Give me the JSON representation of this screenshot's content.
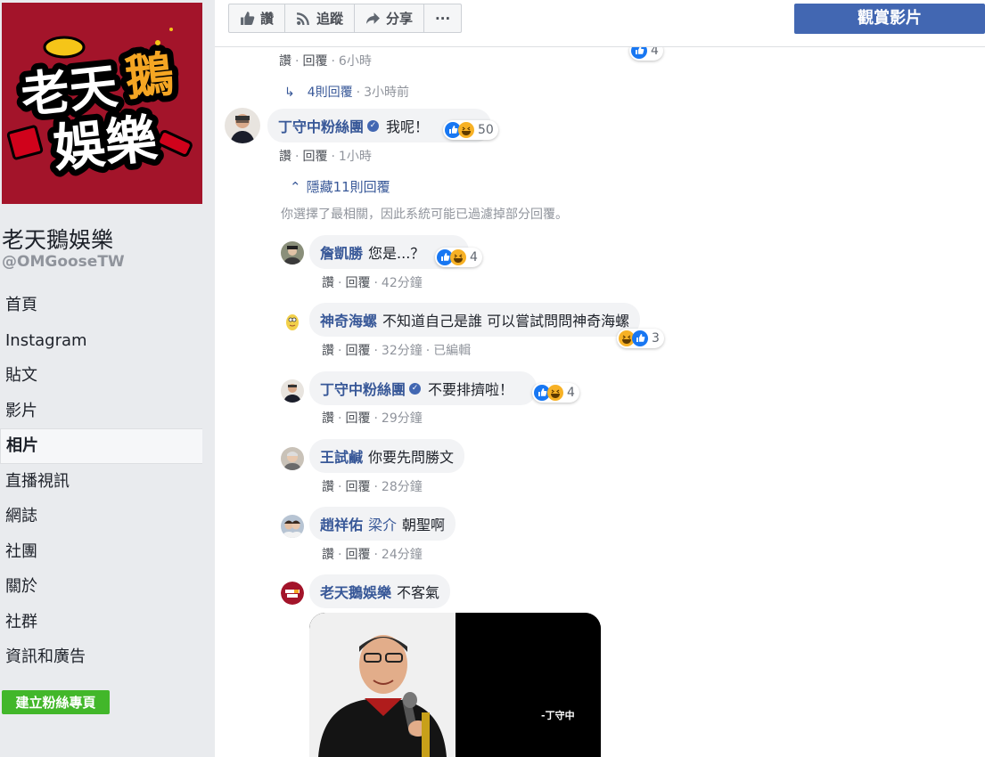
{
  "page": {
    "name": "老天鵝娛樂",
    "handle": "@OMGooseTW",
    "logo_line1": "老天鵝",
    "logo_line2": "娛樂"
  },
  "nav": {
    "items": [
      "首頁",
      "Instagram",
      "貼文",
      "影片",
      "相片",
      "直播視訊",
      "網誌",
      "社團",
      "關於",
      "社群",
      "資訊和廣告"
    ],
    "active": "相片"
  },
  "create_page_button": "建立粉絲專頁",
  "toolbar": {
    "like": "讚",
    "follow": "追蹤",
    "share": "分享",
    "more": "···",
    "watch_video": "觀賞影片"
  },
  "actions": {
    "like": "讚",
    "reply": "回覆",
    "edited": "已編輯"
  },
  "top_partial": {
    "time": "6小時",
    "reaction_count": "4"
  },
  "replies_link": {
    "label": "4則回覆",
    "time": "3小時前"
  },
  "main_comment": {
    "author": "丁守中粉絲團",
    "text": "我呢！",
    "reaction_count": "50",
    "time": "1小時"
  },
  "hide_replies": "隱藏11則回覆",
  "filter_notice": "你選擇了最相關，因此系統可能已過濾掉部分回覆。",
  "replies": [
    {
      "author": "詹凱勝",
      "text": "您是...？",
      "reaction_count": "4",
      "time": "42分鐘"
    },
    {
      "author": "神奇海螺",
      "text": "不知道自己是誰 可以嘗試問問神奇海螺",
      "reaction_count": "3",
      "time": "32分鐘"
    },
    {
      "author": "丁守中粉絲團",
      "text": "不要排擠啦！",
      "reaction_count": "4",
      "time": "29分鐘"
    },
    {
      "author": "王試鹹",
      "text": "你要先問勝文",
      "time": "28分鐘"
    },
    {
      "author": "趙祥佑",
      "mention": "梁介",
      "text": "朝聖啊",
      "time": "24分鐘"
    },
    {
      "author": "老天鵝娛樂",
      "text": "不客氣"
    }
  ],
  "image_caption": "-丁守中",
  "colors": {
    "facebook_blue": "#4267b2",
    "link_blue": "#385898",
    "green": "#42b72a",
    "logo_red": "#a3142a",
    "logo_orange": "#f5a623"
  }
}
